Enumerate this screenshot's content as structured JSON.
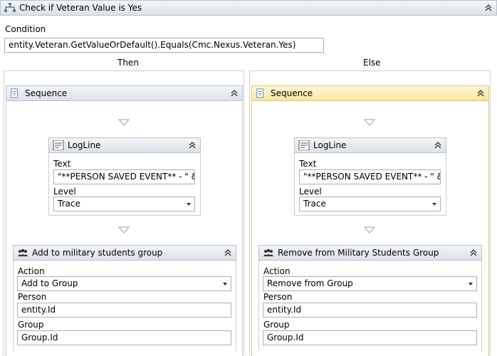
{
  "title": "Check if Veteran Value is Yes",
  "condition": {
    "label": "Condition",
    "value": "entity.Veteran.GetValueOrDefault().Equals(Cmc.Nexus.Veteran.Yes)"
  },
  "then_label": "Then",
  "else_label": "Else",
  "then": {
    "sequence_title": "Sequence",
    "logline": {
      "title": "LogLine",
      "text_label": "Text",
      "text_value": "\"**PERSON SAVED EVENT** - \" & er",
      "level_label": "Level",
      "level_value": "Trace"
    },
    "group_activity": {
      "title": "Add to military students group",
      "action_label": "Action",
      "action_value": "Add to Group",
      "person_label": "Person",
      "person_value": "entity.Id",
      "group_label": "Group",
      "group_value": "Group.Id"
    }
  },
  "else": {
    "sequence_title": "Sequence",
    "logline": {
      "title": "LogLine",
      "text_label": "Text",
      "text_value": "\"**PERSON SAVED EVENT** - \" & er",
      "level_label": "Level",
      "level_value": "Trace"
    },
    "group_activity": {
      "title": "Remove from Military Students Group",
      "action_label": "Action",
      "action_value": "Remove from Group",
      "person_label": "Person",
      "person_value": "entity.Id",
      "group_label": "Group",
      "group_value": "Group.Id"
    }
  },
  "icons": {
    "if": "if-activity-icon",
    "sequence": "sequence-icon",
    "logline": "logline-icon",
    "group": "group-users-icon",
    "collapse": "collapse-chevron-icon"
  },
  "colors": {
    "selected_header": "#f8e6a0",
    "selected_border": "#e2c777",
    "header": "#dde2e8"
  }
}
